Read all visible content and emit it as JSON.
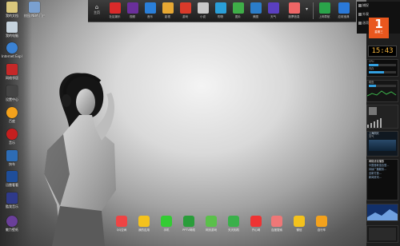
{
  "desktop_icons": [
    {
      "label": "我的文档",
      "color": "#d9c77c"
    },
    {
      "label": "我的电脑",
      "color": "#c6d3dd"
    },
    {
      "label": "Internet Explorer",
      "color": "#3b82d3"
    },
    {
      "label": "网络邻居",
      "color": "#c62828"
    },
    {
      "label": "设置中心",
      "color": "#444444"
    },
    {
      "label": "百度",
      "color": "#f4a21c"
    },
    {
      "label": "音乐",
      "color": "#c41f1f"
    },
    {
      "label": "快车",
      "color": "#2d6cb5"
    },
    {
      "label": "迅雷看看",
      "color": "#1f4e9a"
    },
    {
      "label": "酷我音乐",
      "color": "#2f3a8a"
    },
    {
      "label": "魅力壁纸",
      "color": "#6a3f9a"
    }
  ],
  "desktop_icon_top": {
    "label": "校园 NBA 门户",
    "color": "#7aa0d0"
  },
  "toolbar": {
    "home_label": "主页",
    "items": [
      {
        "label": "社区娱乐",
        "color": "#d92a2a"
      },
      {
        "label": "视频",
        "color": "#6a2f9a"
      },
      {
        "label": "音乐",
        "color": "#2a7fd9"
      },
      {
        "label": "影视",
        "color": "#e7a833"
      },
      {
        "label": "游戏",
        "color": "#d93a2a"
      },
      {
        "label": "小说",
        "color": "#c9c9c9"
      },
      {
        "label": "购物",
        "color": "#2a9fd9"
      },
      {
        "label": "图片",
        "color": "#3fae48"
      },
      {
        "label": "美图",
        "color": "#2b7dc9"
      },
      {
        "label": "天气",
        "color": "#5a3fbf"
      },
      {
        "label": "股票信息",
        "color": "#e66"
      },
      {
        "label": "上网导航",
        "color": "#2aa34a"
      },
      {
        "label": "应用宝典",
        "color": "#2a79d9"
      }
    ]
  },
  "right_menu": [
    "捕捉",
    "外观",
    "选项"
  ],
  "calendar": {
    "day": "1",
    "month": "星期三"
  },
  "clock": {
    "time": "15:43"
  },
  "system_stats": {
    "cpu_label": "CPU",
    "cpu_load": 0.35,
    "mem_label": "内存",
    "mem_load": 0.55,
    "disk_label": "磁盘",
    "disk_load": 0.25
  },
  "weather": {
    "title": "上海阴天",
    "temp": "天气"
  },
  "news": {
    "title": "网络优化播放",
    "lines": [
      "中国首款混合型...",
      "持续广播服务...",
      "全新打造...",
      "新闻资讯..."
    ]
  },
  "dock": [
    {
      "label": "QQ空间",
      "color": "#e44"
    },
    {
      "label": "我的应用",
      "color": "#f4c21c"
    },
    {
      "label": "手机",
      "color": "#3c3"
    },
    {
      "label": "PPTV网络",
      "color": "#2a9d3a"
    },
    {
      "label": "网页游戏",
      "color": "#5ac04a"
    },
    {
      "label": "天天相机",
      "color": "#3ab04a"
    },
    {
      "label": "开心网",
      "color": "#e33"
    },
    {
      "label": "百度搜索",
      "color": "#e77"
    },
    {
      "label": "微信",
      "color": "#f4c21c"
    },
    {
      "label": "自行车",
      "color": "#f4a21c"
    }
  ],
  "desktop_icon_bottom": {
    "label": "魅力主题",
    "color": "#7a4fb0"
  }
}
